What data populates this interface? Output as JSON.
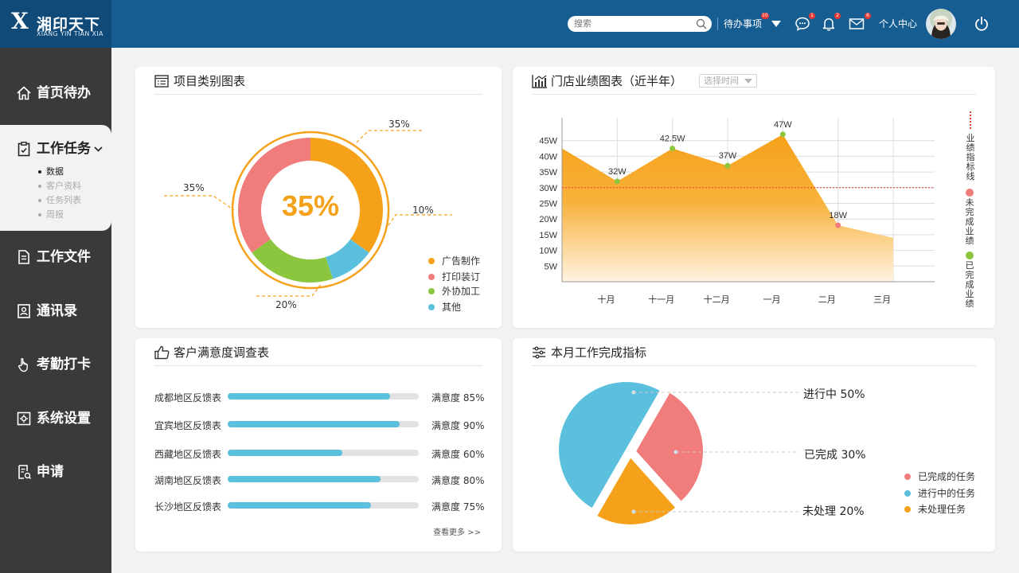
{
  "header": {
    "logo_mark": "X",
    "logo_cn": "湘印天下",
    "logo_en": "XIANG YIN TIAN XIA",
    "search_placeholder": "搜索",
    "todo_label": "待办事项",
    "todo_badge": "10",
    "chat_badge": "1",
    "bell_badge": "2",
    "mail_badge": "6",
    "personal_center": "个人中心"
  },
  "sidebar": {
    "items": [
      {
        "label": "首页待办",
        "icon": "home-icon"
      },
      {
        "label": "工作任务",
        "icon": "clipboard-icon"
      },
      {
        "label": "工作文件",
        "icon": "document-icon"
      },
      {
        "label": "通讯录",
        "icon": "contacts-icon"
      },
      {
        "label": "考勤打卡",
        "icon": "hand-icon"
      },
      {
        "label": "系统设置",
        "icon": "gear-icon"
      },
      {
        "label": "申请",
        "icon": "form-icon"
      }
    ],
    "subitems": [
      "数据",
      "客户资料",
      "任务列表",
      "周报"
    ]
  },
  "card1": {
    "title": "项目类别图表",
    "center_value": "35%",
    "legend": [
      {
        "label": "广告制作",
        "color": "#f6a11a"
      },
      {
        "label": "打印装订",
        "color": "#f07c7c"
      },
      {
        "label": "外协加工",
        "color": "#8cc63f"
      },
      {
        "label": "其他",
        "color": "#5bc0dd"
      }
    ],
    "callouts": [
      "35%",
      "35%",
      "10%",
      "20%"
    ]
  },
  "card2": {
    "title": "门店业绩图表（近半年）",
    "select_placeholder": "选择时间",
    "side_labels": [
      "业绩指标线",
      "未完成业绩",
      "已完成业绩"
    ],
    "side_colors": [
      "#e53935",
      "#f07c7c",
      "#8cc63f"
    ]
  },
  "card3": {
    "title": "客户满意度调查表",
    "rows": [
      {
        "name": "成都地区反馈表",
        "pct": "满意度 85%"
      },
      {
        "name": "宜宾地区反馈表",
        "pct": "满意度 90%"
      },
      {
        "name": "西藏地区反馈表",
        "pct": "满意度 60%"
      },
      {
        "name": "湖南地区反馈表",
        "pct": "满意度 80%"
      },
      {
        "name": "长沙地区反馈表",
        "pct": "满意度 75%"
      }
    ],
    "more": "查看更多 >>"
  },
  "card4": {
    "title": "本月工作完成指标",
    "callouts": [
      "进行中 50%",
      "已完成 30%",
      "未处理 20%"
    ],
    "legend": [
      {
        "label": "已完成的任务",
        "color": "#f07c7c"
      },
      {
        "label": "进行中的任务",
        "color": "#5bc0dd"
      },
      {
        "label": "未处理任务",
        "color": "#f6a11a"
      }
    ]
  },
  "chart_data": [
    {
      "type": "pie",
      "title": "项目类别图表",
      "categories": [
        "广告制作",
        "打印装订",
        "外协加工",
        "其他"
      ],
      "values": [
        35,
        35,
        20,
        10
      ]
    },
    {
      "type": "area",
      "title": "门店业绩图表（近半年）",
      "categories": [
        "十月",
        "十一月",
        "十二月",
        "一月",
        "二月",
        "三月"
      ],
      "x": [
        4,
        9,
        14,
        19,
        24,
        29
      ],
      "yticks": [
        "5W",
        "10W",
        "15W",
        "20W",
        "25W",
        "30W",
        "35W",
        "40W",
        "45W"
      ],
      "ylim": [
        0,
        50
      ],
      "series": [
        {
          "x": [
            0,
            5,
            10,
            15,
            20,
            25,
            30
          ],
          "values": [
            42.5,
            32,
            42.5,
            37,
            47,
            18,
            14
          ]
        }
      ],
      "data_labels": [
        {
          "x": 5,
          "value": 32,
          "label": "32W",
          "status": "met"
        },
        {
          "x": 10,
          "value": 42.5,
          "label": "42.5W",
          "status": "met"
        },
        {
          "x": 15,
          "value": 37,
          "label": "37W",
          "status": "met"
        },
        {
          "x": 20,
          "value": 47,
          "label": "47W",
          "status": "met"
        },
        {
          "x": 25,
          "value": 18,
          "label": "18W",
          "status": "unmet"
        }
      ],
      "target_line": 30
    },
    {
      "type": "bar",
      "title": "客户满意度调查表",
      "categories": [
        "成都地区反馈表",
        "宜宾地区反馈表",
        "西藏地区反馈表",
        "湖南地区反馈表",
        "长沙地区反馈表"
      ],
      "values": [
        85,
        90,
        60,
        80,
        75
      ],
      "ylim": [
        0,
        100
      ]
    },
    {
      "type": "pie",
      "title": "本月工作完成指标",
      "categories": [
        "进行中",
        "已完成",
        "未处理"
      ],
      "values": [
        50,
        30,
        20
      ]
    }
  ]
}
